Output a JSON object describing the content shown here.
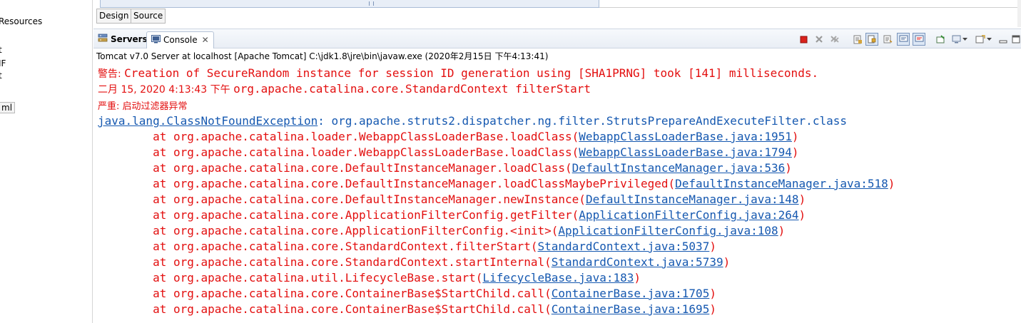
{
  "left_pane": {
    "items": [
      "Resources",
      "t",
      "IF",
      "t",
      "ml"
    ]
  },
  "editor": {
    "tabs": [
      "Design",
      "Source"
    ]
  },
  "view": {
    "tabs": [
      {
        "label": "Servers",
        "icon": "servers-icon"
      },
      {
        "label": "Console",
        "icon": "console-icon",
        "close": "✕"
      }
    ],
    "toolbar_icons": [
      "terminate-icon",
      "remove-launch-icon",
      "remove-all-terminated-icon",
      "clear-console-icon",
      "scroll-lock-icon",
      "word-wrap-icon",
      "show-on-stdout-icon",
      "show-on-stderr-icon",
      "pin-console-icon",
      "display-selected-console-icon",
      "dropdown-icon",
      "open-console-icon",
      "dropdown-icon",
      "minimize-icon",
      "maximize-icon"
    ]
  },
  "console": {
    "description": "Tomcat v7.0 Server at localhost [Apache Tomcat] C:\\jdk1.8\\jre\\bin\\javaw.exe (2020年2月15日 下午4:13:41)",
    "lines": [
      {
        "prefix": "警告: ",
        "text": "Creation of SecureRandom instance for session ID generation using [SHA1PRNG] took [141] milliseconds."
      },
      {
        "prefix": "二月 15, 2020 4:13:43 下午 ",
        "text": "org.apache.catalina.core.StandardContext filterStart"
      },
      {
        "prefix": "严重: 启动过滤器异常",
        "text": ""
      },
      {
        "exception": "java.lang.ClassNotFoundException",
        "text": ": org.apache.struts2.dispatcher.ng.filter.StrutsPrepareAndExecuteFilter.class"
      },
      {
        "at": "        at org.apache.catalina.loader.WebappClassLoaderBase.loadClass(",
        "link": "WebappClassLoaderBase.java:1951",
        "end": ")"
      },
      {
        "at": "        at org.apache.catalina.loader.WebappClassLoaderBase.loadClass(",
        "link": "WebappClassLoaderBase.java:1794",
        "end": ")"
      },
      {
        "at": "        at org.apache.catalina.core.DefaultInstanceManager.loadClass(",
        "link": "DefaultInstanceManager.java:536",
        "end": ")"
      },
      {
        "at": "        at org.apache.catalina.core.DefaultInstanceManager.loadClassMaybePrivileged(",
        "link": "DefaultInstanceManager.java:518",
        "end": ")"
      },
      {
        "at": "        at org.apache.catalina.core.DefaultInstanceManager.newInstance(",
        "link": "DefaultInstanceManager.java:148",
        "end": ")"
      },
      {
        "at": "        at org.apache.catalina.core.ApplicationFilterConfig.getFilter(",
        "link": "ApplicationFilterConfig.java:264",
        "end": ")"
      },
      {
        "at": "        at org.apache.catalina.core.ApplicationFilterConfig.<init>(",
        "link": "ApplicationFilterConfig.java:108",
        "end": ")"
      },
      {
        "at": "        at org.apache.catalina.core.StandardContext.filterStart(",
        "link": "StandardContext.java:5037",
        "end": ")"
      },
      {
        "at": "        at org.apache.catalina.core.StandardContext.startInternal(",
        "link": "StandardContext.java:5739",
        "end": ")"
      },
      {
        "at": "        at org.apache.catalina.util.LifecycleBase.start(",
        "link": "LifecycleBase.java:183",
        "end": ")"
      },
      {
        "at": "        at org.apache.catalina.core.ContainerBase$StartChild.call(",
        "link": "ContainerBase.java:1705",
        "end": ")"
      },
      {
        "at": "        at org.apache.catalina.core.ContainerBase$StartChild.call(",
        "link": "ContainerBase.java:1695",
        "end": ")"
      }
    ]
  },
  "colors": {
    "error_text": "#e30f0f",
    "link": "#1558b0",
    "header_bg": "#e9eef5"
  }
}
